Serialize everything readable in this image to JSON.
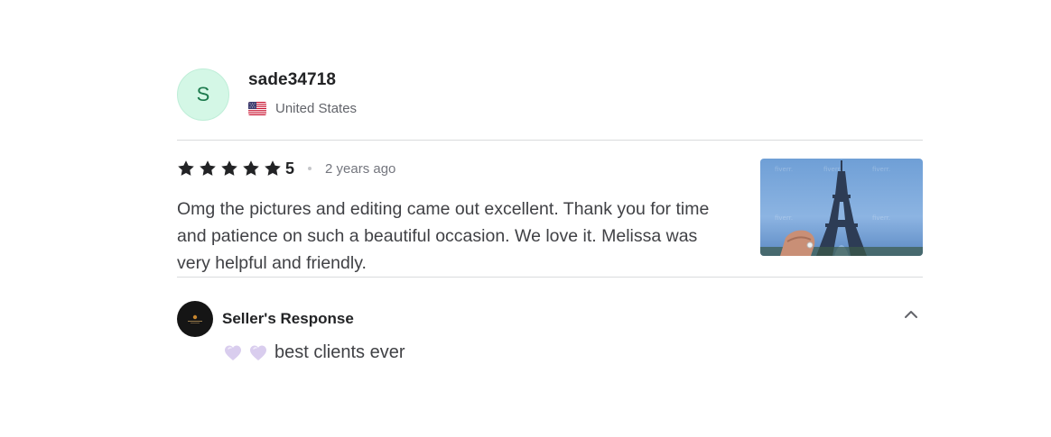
{
  "reviewer": {
    "initial": "S",
    "username": "sade34718",
    "country": "United States",
    "flag_icon": "us-flag-icon"
  },
  "review": {
    "rating": "5",
    "rating_fraction": 1.0,
    "stars_filled": 5,
    "time_ago": "2 years ago",
    "text": "Omg the pictures and editing came out excellent. Thank you for time and patience on such a beautiful occasion. We love it. Melissa was very helpful and friendly.",
    "thumbnail_icon": "eiffel-tower-photo"
  },
  "seller_response": {
    "title": "Seller's Response",
    "text": "best clients ever",
    "emoji_icons": [
      "purple-heart-icon",
      "purple-heart-icon"
    ]
  },
  "colors": {
    "avatar_bg": "#d4f7e6",
    "avatar_text": "#1c7a4d",
    "star": "#222325",
    "divider": "#dadbdd"
  }
}
